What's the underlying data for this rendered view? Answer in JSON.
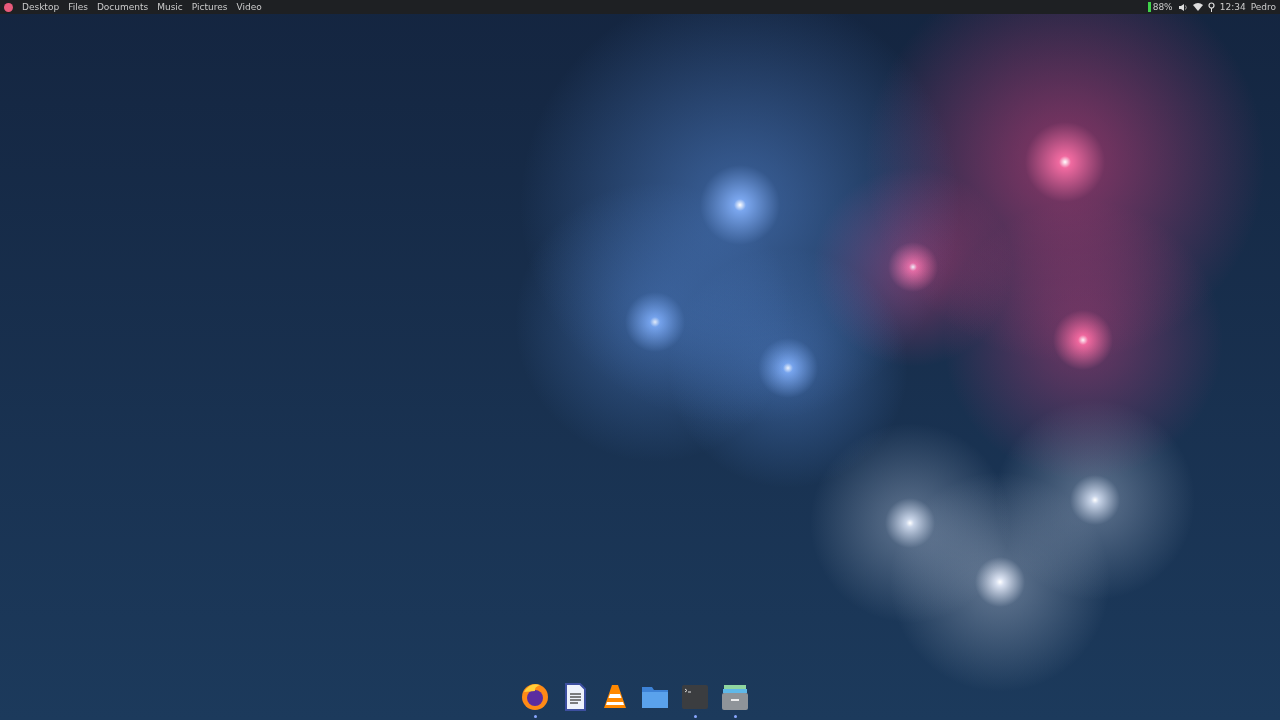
{
  "top_bar": {
    "menu": [
      "Desktop",
      "Files",
      "Documents",
      "Music",
      "Pictures",
      "Video"
    ],
    "battery": "88%",
    "clock": "12:34",
    "user": "Pedro"
  },
  "dock": [
    {
      "kind": "browser",
      "running": true
    },
    {
      "kind": "document",
      "running": false
    },
    {
      "kind": "cone",
      "running": false
    },
    {
      "kind": "folder",
      "running": false
    },
    {
      "kind": "terminal",
      "running": true
    },
    {
      "kind": "archive",
      "running": true
    }
  ]
}
